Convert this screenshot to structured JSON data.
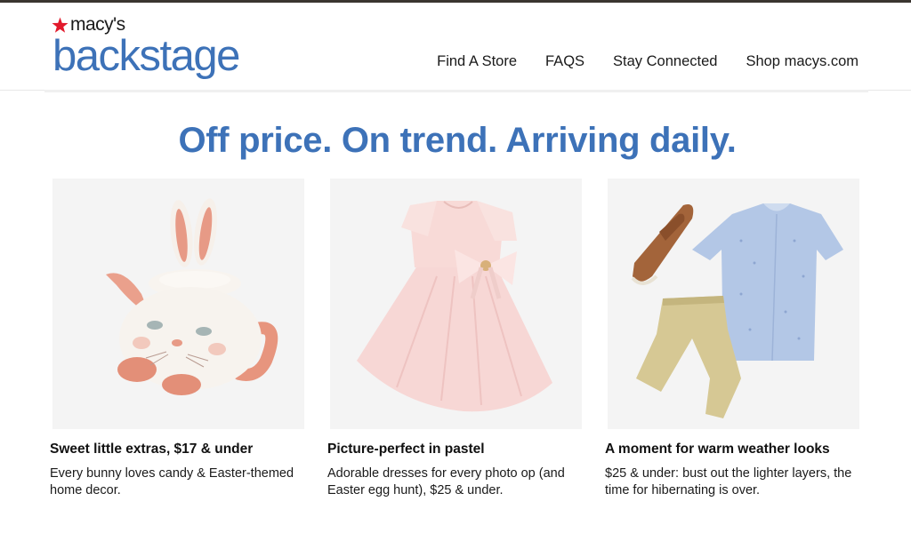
{
  "brand": {
    "macys": "macy's",
    "backstage": "backstage",
    "star_color": "#e21a2c",
    "brand_blue": "#3d72b8"
  },
  "nav": {
    "items": [
      "Find A Store",
      "FAQS",
      "Stay Connected",
      "Shop macys.com"
    ]
  },
  "headline": "Off price. On trend. Arriving daily.",
  "cards": [
    {
      "title": "Sweet little extras, $17 & under",
      "description": "Every bunny loves candy & Easter-themed home decor."
    },
    {
      "title": "Picture-perfect in pastel",
      "description": "Adorable dresses for every photo op (and Easter egg hunt), $25 & under."
    },
    {
      "title": "A moment for warm weather looks",
      "description": "$25 & under: bust out the lighter layers, the time for hibernating is over."
    }
  ]
}
